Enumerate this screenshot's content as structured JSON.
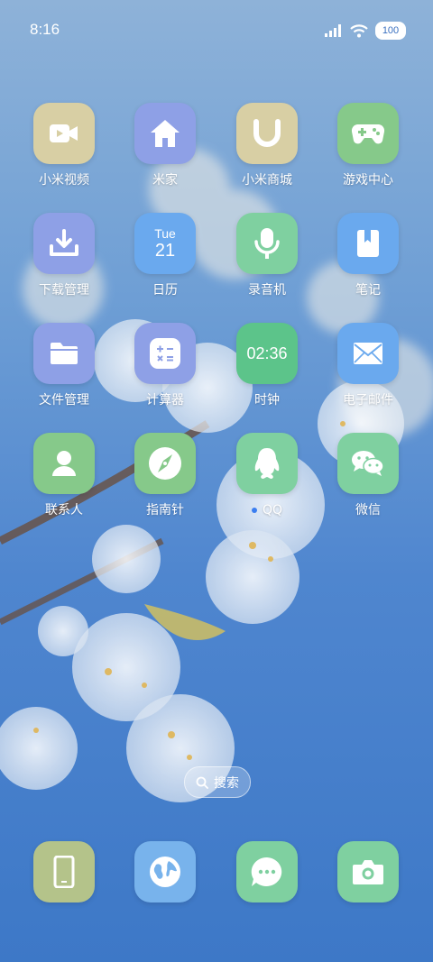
{
  "status_bar": {
    "time": "8:16",
    "battery": "100"
  },
  "apps": [
    {
      "label": "小米视频",
      "icon": "video-camera-icon",
      "color": "#d8cfa4"
    },
    {
      "label": "米家",
      "icon": "home-icon",
      "color": "#8ea0e6"
    },
    {
      "label": "小米商城",
      "icon": "mi-store-icon",
      "color": "#d8cfa4"
    },
    {
      "label": "游戏中心",
      "icon": "gamepad-icon",
      "color": "#86c98a"
    },
    {
      "label": "下载管理",
      "icon": "download-icon",
      "color": "#8ea0e6"
    },
    {
      "label": "日历",
      "icon": "calendar-icon",
      "color": "#6aa9ee",
      "day": "Tue",
      "date": "21"
    },
    {
      "label": "录音机",
      "icon": "microphone-icon",
      "color": "#7fd0a0"
    },
    {
      "label": "笔记",
      "icon": "notebook-icon",
      "color": "#6aa9ee"
    },
    {
      "label": "文件管理",
      "icon": "folder-icon",
      "color": "#8ea0e6"
    },
    {
      "label": "计算器",
      "icon": "calculator-icon",
      "color": "#8ea0e6"
    },
    {
      "label": "时钟",
      "icon": "clock-icon",
      "color": "#5cc48a",
      "time": "02:36"
    },
    {
      "label": "电子邮件",
      "icon": "mail-icon",
      "color": "#6aa9ee"
    },
    {
      "label": "联系人",
      "icon": "contact-icon",
      "color": "#86c98a"
    },
    {
      "label": "指南针",
      "icon": "compass-icon",
      "color": "#86c98a"
    },
    {
      "label": "QQ",
      "icon": "penguin-icon",
      "color": "#7fd0a0"
    },
    {
      "label": "微信",
      "icon": "wechat-icon",
      "color": "#7fd0a0"
    }
  ],
  "search": {
    "label": "搜索"
  },
  "dock": [
    {
      "icon": "phone-icon",
      "color": "#b4c38a"
    },
    {
      "icon": "browser-globe-icon",
      "color": "#78b3ec"
    },
    {
      "icon": "messages-icon",
      "color": "#7fd0a0"
    },
    {
      "icon": "camera-icon",
      "color": "#7fd0a0"
    }
  ]
}
